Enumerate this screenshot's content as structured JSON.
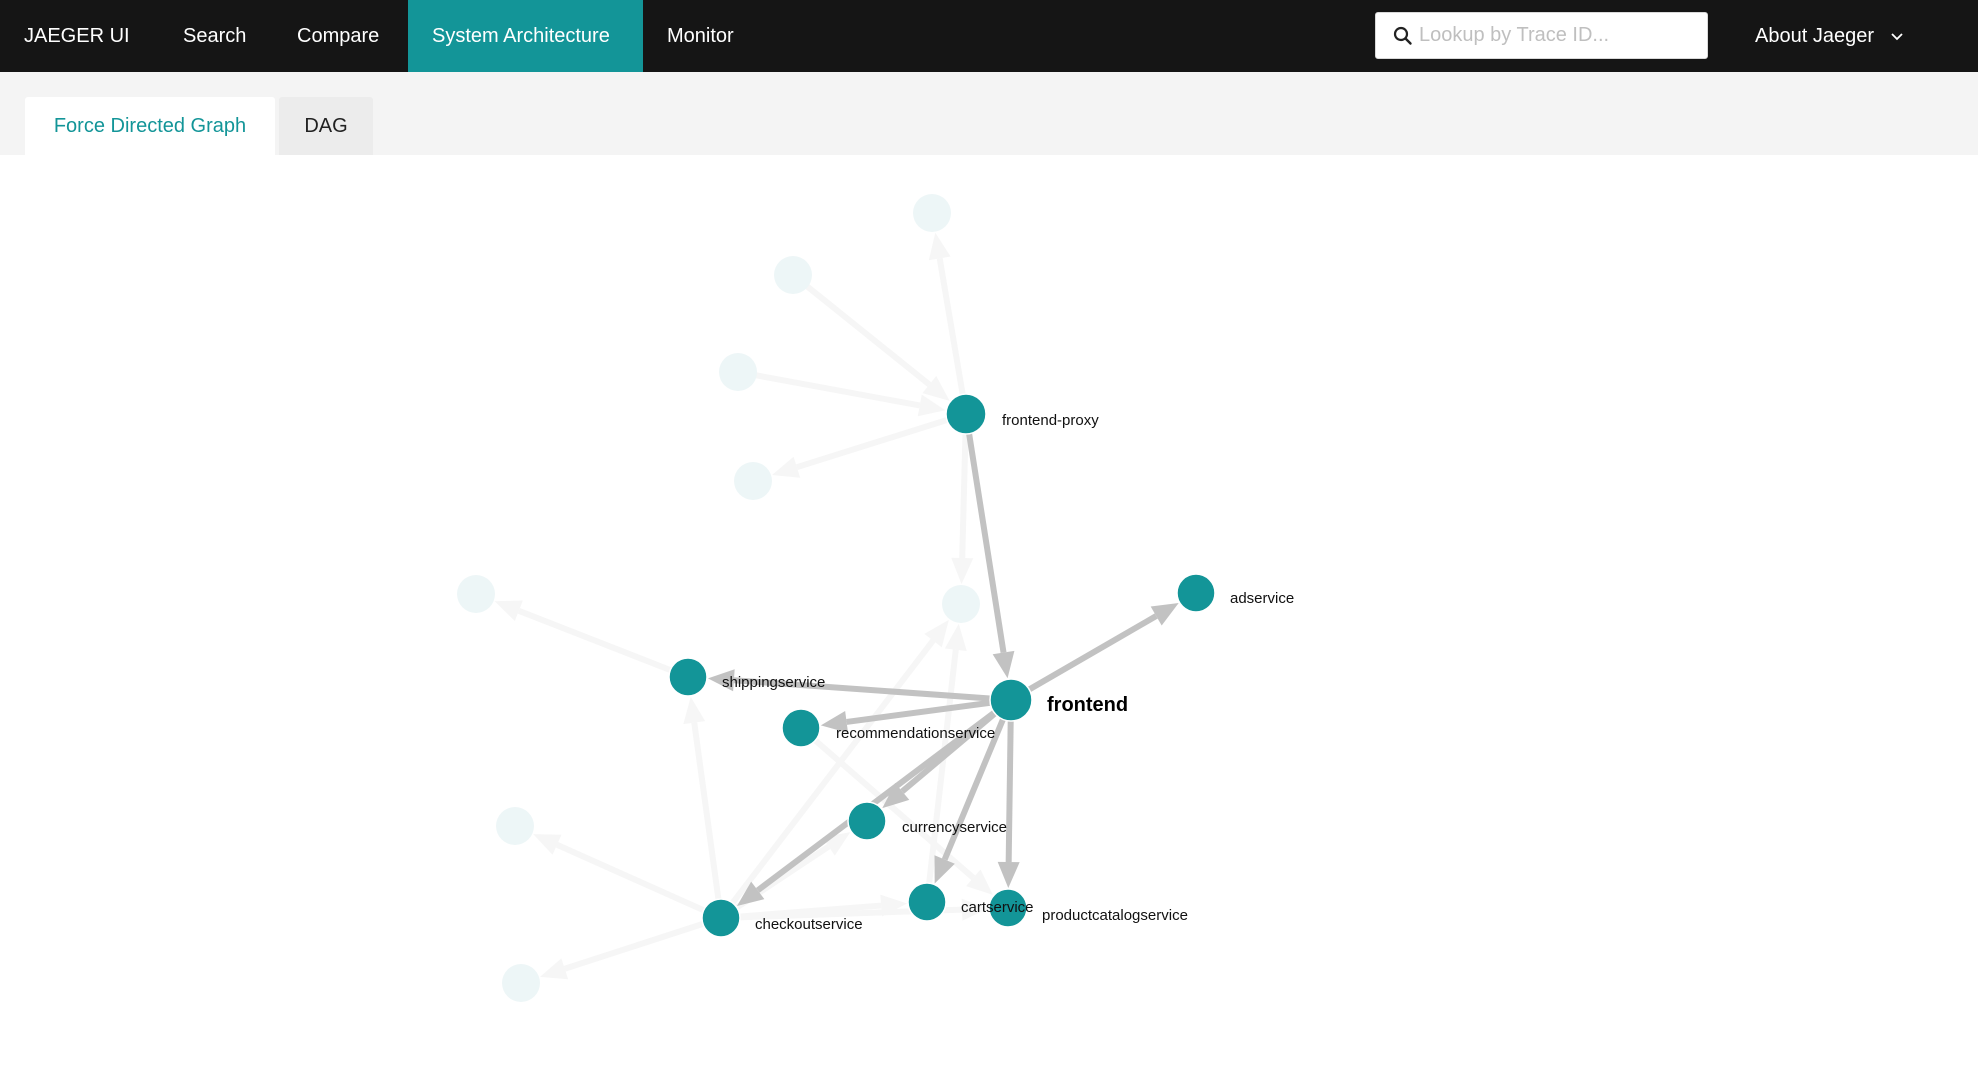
{
  "nav": {
    "brand": "JAEGER UI",
    "items": [
      {
        "label": "Search",
        "active": false
      },
      {
        "label": "Compare",
        "active": false
      },
      {
        "label": "System Architecture",
        "active": true
      },
      {
        "label": "Monitor",
        "active": false
      }
    ],
    "search": {
      "placeholder": "Lookup by Trace ID...",
      "value": "",
      "icon": "search-icon"
    },
    "about": {
      "label": "About Jaeger",
      "icon": "chevron-down-icon"
    }
  },
  "tabs": [
    {
      "label": "Force Directed Graph",
      "active": true
    },
    {
      "label": "DAG",
      "active": false
    }
  ],
  "colors": {
    "accent": "#139598",
    "header_bg": "#151515",
    "node": "#139598",
    "node_faded": "#edf6f7",
    "edge": "#c2c2c2",
    "edge_faded": "#f6f6f6"
  },
  "graph": {
    "focus_node": "frontend",
    "nodes": [
      {
        "id": "frontend-proxy",
        "label": "frontend-proxy",
        "highlighted": true
      },
      {
        "id": "adservice",
        "label": "adservice",
        "highlighted": true
      },
      {
        "id": "frontend",
        "label": "frontend",
        "highlighted": true
      },
      {
        "id": "shippingservice",
        "label": "shippingservice",
        "highlighted": true
      },
      {
        "id": "recommendationservice",
        "label": "recommendationservice",
        "highlighted": true
      },
      {
        "id": "currencyservice",
        "label": "currencyservice",
        "highlighted": true
      },
      {
        "id": "checkoutservice",
        "label": "checkoutservice",
        "highlighted": true
      },
      {
        "id": "cartservice",
        "label": "cartservice",
        "highlighted": true
      },
      {
        "id": "productcatalogservice",
        "label": "productcatalogservice",
        "highlighted": true
      },
      {
        "id": "faded-1",
        "label": "",
        "highlighted": false
      },
      {
        "id": "faded-2",
        "label": "",
        "highlighted": false
      },
      {
        "id": "faded-3",
        "label": "",
        "highlighted": false
      },
      {
        "id": "faded-4",
        "label": "",
        "highlighted": false
      },
      {
        "id": "faded-5",
        "label": "",
        "highlighted": false
      },
      {
        "id": "faded-6",
        "label": "",
        "highlighted": false
      },
      {
        "id": "faded-7",
        "label": "",
        "highlighted": false
      },
      {
        "id": "faded-8",
        "label": "",
        "highlighted": false
      }
    ],
    "edges": [
      {
        "source": "frontend-proxy",
        "target": "frontend",
        "highlighted": true
      },
      {
        "source": "frontend",
        "target": "adservice",
        "highlighted": true
      },
      {
        "source": "frontend",
        "target": "shippingservice",
        "highlighted": true
      },
      {
        "source": "frontend",
        "target": "recommendationservice",
        "highlighted": true
      },
      {
        "source": "frontend",
        "target": "currencyservice",
        "highlighted": true
      },
      {
        "source": "frontend",
        "target": "checkoutservice",
        "highlighted": true
      },
      {
        "source": "frontend",
        "target": "cartservice",
        "highlighted": true
      },
      {
        "source": "frontend",
        "target": "productcatalogservice",
        "highlighted": true
      },
      {
        "source": "frontend-proxy",
        "target": "faded-1",
        "highlighted": false
      },
      {
        "source": "faded-2",
        "target": "frontend-proxy",
        "highlighted": false
      },
      {
        "source": "faded-3",
        "target": "frontend-proxy",
        "highlighted": false
      },
      {
        "source": "frontend-proxy",
        "target": "faded-4",
        "highlighted": false
      },
      {
        "source": "frontend-proxy",
        "target": "faded-6",
        "highlighted": false
      },
      {
        "source": "shippingservice",
        "target": "faded-5",
        "highlighted": false
      },
      {
        "source": "checkoutservice",
        "target": "shippingservice",
        "highlighted": false
      },
      {
        "source": "checkoutservice",
        "target": "faded-7",
        "highlighted": false
      },
      {
        "source": "checkoutservice",
        "target": "faded-8",
        "highlighted": false
      },
      {
        "source": "checkoutservice",
        "target": "cartservice",
        "highlighted": false
      },
      {
        "source": "checkoutservice",
        "target": "currencyservice",
        "highlighted": false
      },
      {
        "source": "checkoutservice",
        "target": "faded-6",
        "highlighted": false
      },
      {
        "source": "cartservice",
        "target": "faded-6",
        "highlighted": false
      },
      {
        "source": "recommendationservice",
        "target": "productcatalogservice",
        "highlighted": false
      },
      {
        "source": "checkoutservice",
        "target": "productcatalogservice",
        "highlighted": false
      }
    ]
  }
}
